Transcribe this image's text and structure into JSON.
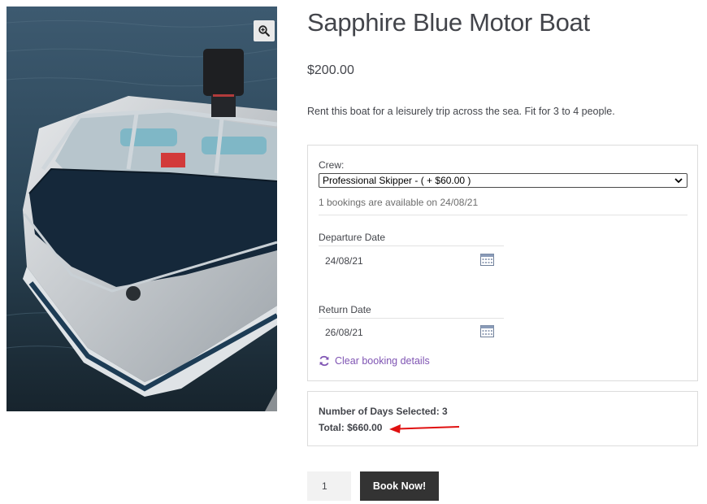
{
  "product": {
    "title": "Sapphire Blue Motor Boat",
    "price": "$200.00",
    "description": "Rent this boat for a leisurely trip across the sea.  Fit for 3 to 4 people.",
    "image_icon": "zoom-in-icon"
  },
  "booking": {
    "crew_label": "Crew:",
    "crew_selected": "Professional Skipper - ( + $60.00 )",
    "availability": "1 bookings are available on 24/08/21",
    "departure_label": "Departure Date",
    "departure_value": "24/08/21",
    "return_label": "Return Date",
    "return_value": "26/08/21",
    "clear_label": "Clear booking details"
  },
  "summary": {
    "days_label": "Number of Days Selected: 3",
    "total_label": "Total: $660.00"
  },
  "cart": {
    "quantity": "1",
    "book_label": "Book Now!"
  },
  "colors": {
    "link": "#7f54b3",
    "button": "#333333",
    "arrow": "#e01010"
  }
}
